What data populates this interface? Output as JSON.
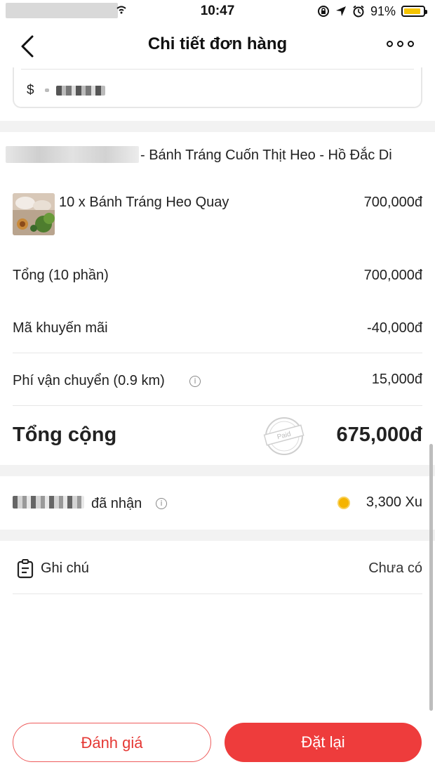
{
  "status_bar": {
    "time": "10:47",
    "battery_percent": "91%",
    "battery_level": 0.91
  },
  "header": {
    "title": "Chi tiết đơn hàng"
  },
  "address": {
    "prefix": "$"
  },
  "shop": {
    "name_suffix": "- Bánh Tráng Cuốn Thịt Heo - Hồ Đắc Di"
  },
  "item": {
    "name": "10 x Bánh Tráng Heo Quay",
    "price": "700,000đ"
  },
  "summary": {
    "subtotal_label": "Tổng (10 phần)",
    "subtotal_value": "700,000đ",
    "promo_label": "Mã khuyến mãi",
    "promo_value": "-40,000đ",
    "shipping_label": "Phí vận chuyển (0.9 km)",
    "shipping_value": "15,000đ",
    "total_label": "Tổng cộng",
    "total_value": "675,000đ",
    "stamp": "Paid"
  },
  "reward": {
    "label_suffix": "đã nhận",
    "value": "3,300 Xu"
  },
  "note": {
    "label": "Ghi chú",
    "value": "Chưa có"
  },
  "actions": {
    "rate": "Đánh giá",
    "reorder": "Đặt lại"
  },
  "colors": {
    "accent": "#ee3c3c",
    "coin": "#f5b400",
    "battery": "#f5c400"
  }
}
